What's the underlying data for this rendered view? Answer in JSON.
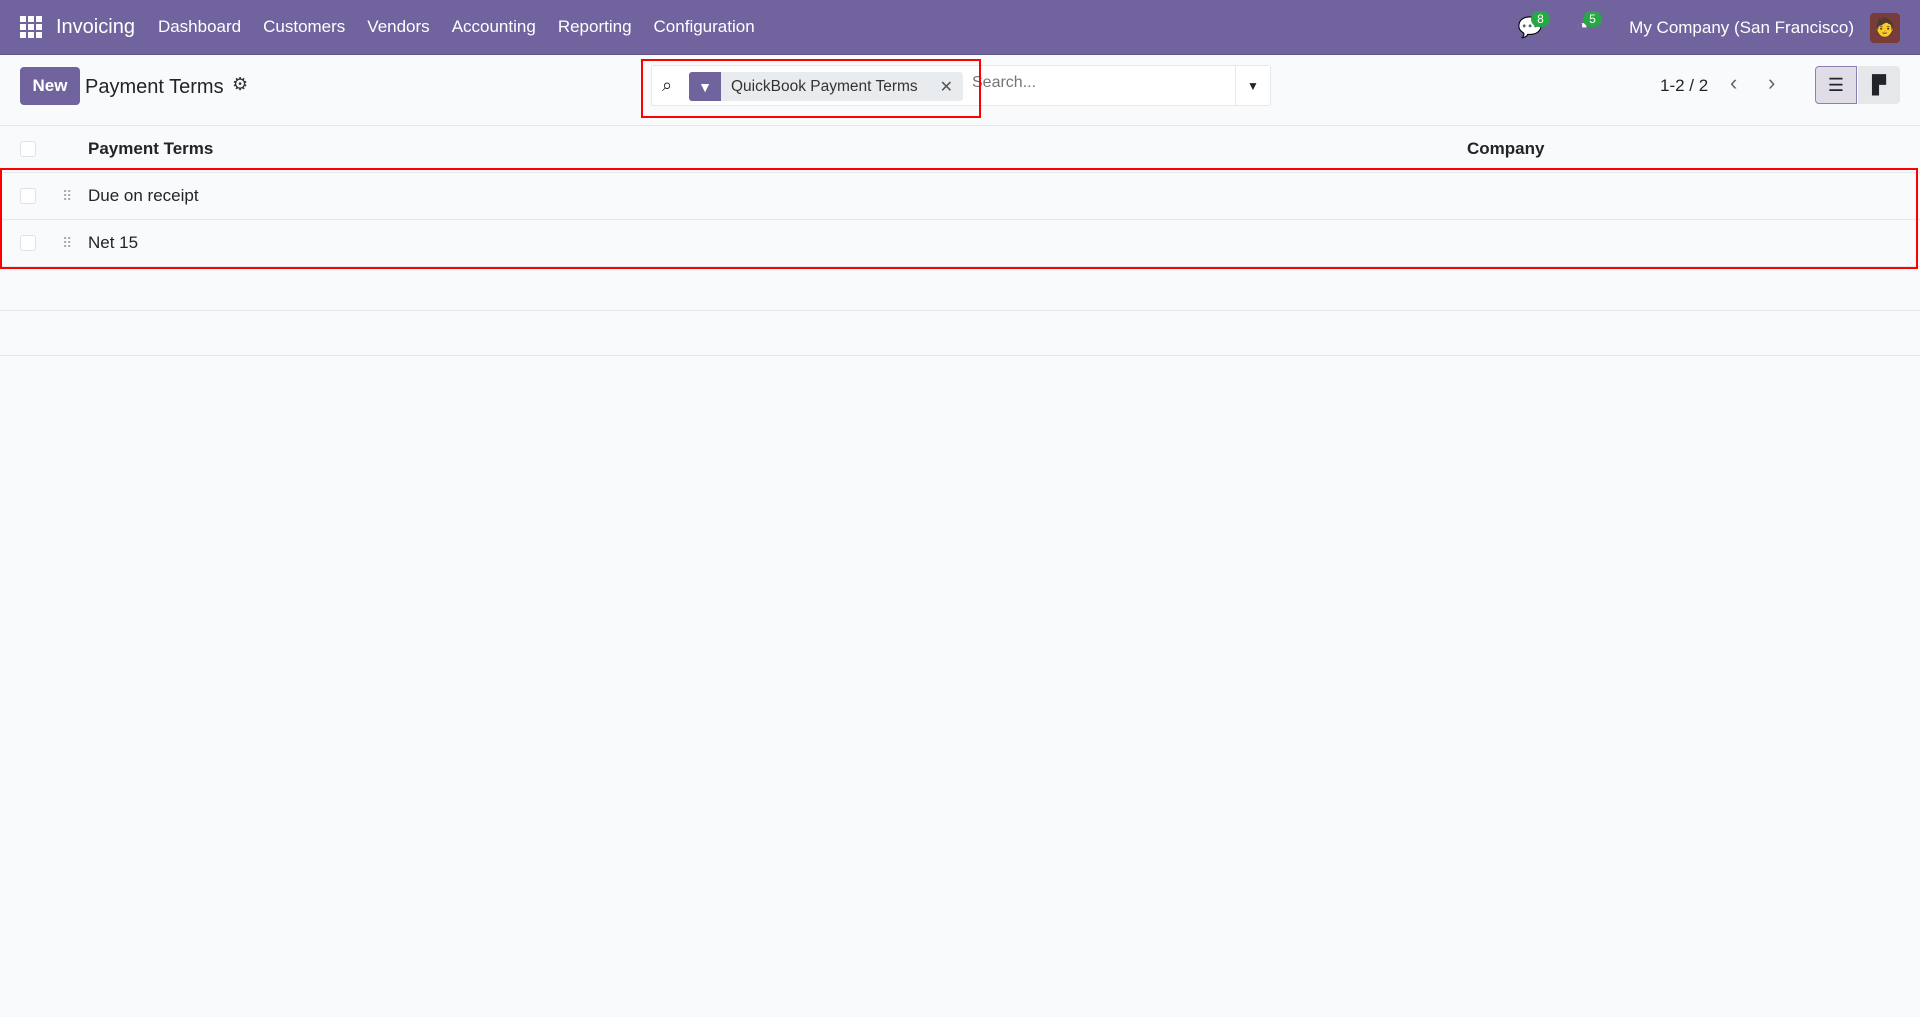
{
  "navbar": {
    "app": "Invoicing",
    "menus": [
      "Dashboard",
      "Customers",
      "Vendors",
      "Accounting",
      "Reporting",
      "Configuration"
    ],
    "messages_count": "8",
    "activities_count": "5",
    "company": "My Company (San Francisco)"
  },
  "control": {
    "new_label": "New",
    "title": "Payment Terms",
    "facet": "QuickBook Payment Terms",
    "search_placeholder": "Search...",
    "pager": "1-2 / 2"
  },
  "list": {
    "columns": [
      "Payment Terms",
      "Company"
    ],
    "rows": [
      {
        "name": "Due on receipt",
        "company": ""
      },
      {
        "name": "Net 15",
        "company": ""
      }
    ]
  },
  "colors": {
    "brand": "#71639e",
    "badge": "#28a745",
    "highlight": "#ff0000"
  }
}
